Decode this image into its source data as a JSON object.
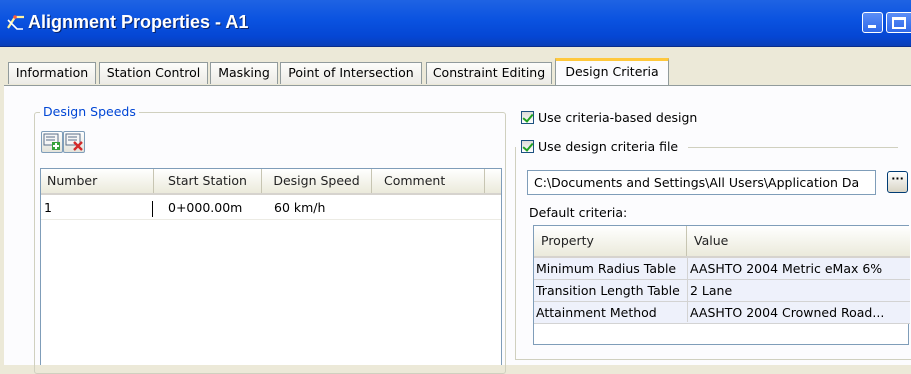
{
  "window": {
    "title": "Alignment Properties - A1",
    "title_bar_color": "#0a52e0",
    "controls": [
      "minimize-icon",
      "maximize-icon"
    ]
  },
  "tabs": [
    {
      "label": "Information",
      "active": false
    },
    {
      "label": "Station Control",
      "active": false
    },
    {
      "label": "Masking",
      "active": false
    },
    {
      "label": "Point of Intersection",
      "active": false
    },
    {
      "label": "Constraint Editing",
      "active": false
    },
    {
      "label": "Design Criteria",
      "active": true
    }
  ],
  "design_speeds": {
    "group_label": "Design Speeds",
    "toolbar": {
      "add_icon": "add-design-speed-icon",
      "delete_icon": "delete-design-speed-icon"
    },
    "columns": [
      "Number",
      "Start Station",
      "Design Speed",
      "Comment"
    ],
    "rows": [
      {
        "number": "1",
        "start_station": "0+000.00m",
        "design_speed": "60 km/h",
        "comment": ""
      }
    ]
  },
  "criteria": {
    "use_criteria_based_design": {
      "label": "Use criteria-based design",
      "checked": true
    },
    "use_design_criteria_file": {
      "label": "Use design criteria file",
      "checked": true
    },
    "file_path": "C:\\Documents and Settings\\All Users\\Application Da",
    "browse_label": "···",
    "default_label": "Default criteria:",
    "columns": [
      "Property",
      "Value"
    ],
    "rows": [
      {
        "property": "Minimum Radius Table",
        "value": "AASHTO 2004 Metric eMax 6%"
      },
      {
        "property": "Transition Length Table",
        "value": "2 Lane"
      },
      {
        "property": "Attainment Method",
        "value": "AASHTO 2004 Crowned Road..."
      }
    ]
  },
  "colors": {
    "accent_tab": "#ffc83c",
    "group_label": "#0046d5",
    "check_mark": "#21a121"
  }
}
